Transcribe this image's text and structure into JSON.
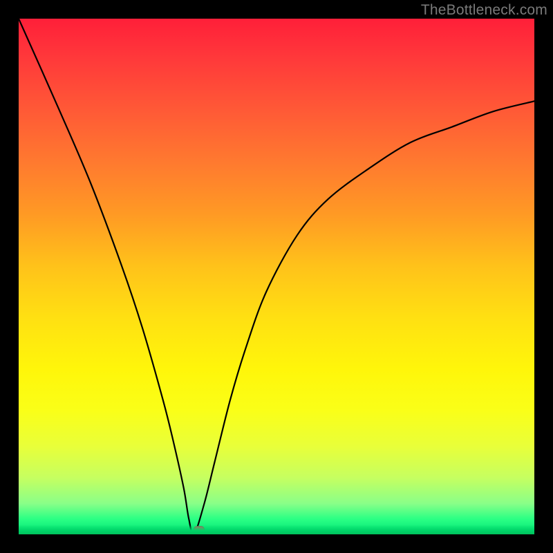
{
  "attribution": "TheBottleneck.com",
  "chart_data": {
    "type": "line",
    "title": "",
    "xlabel": "",
    "ylabel": "",
    "x_range": [
      0,
      100
    ],
    "y_range": [
      0,
      100
    ],
    "min_point": {
      "x": 34,
      "y": 0
    },
    "marker": {
      "x": 35,
      "y": 1,
      "color": "#c9605e"
    },
    "series": [
      {
        "name": "bottleneck-curve",
        "x": [
          0,
          8,
          14,
          20,
          24,
          28,
          30,
          32,
          33,
          34,
          36,
          38,
          41,
          44,
          48,
          54,
          60,
          68,
          76,
          84,
          92,
          100
        ],
        "y": [
          100,
          82,
          68,
          52,
          40,
          26,
          18,
          9,
          3,
          0,
          6,
          14,
          26,
          36,
          47,
          58,
          65,
          71,
          76,
          79,
          82,
          84
        ]
      }
    ],
    "background_gradient": {
      "top": "#ff1f39",
      "middle": "#ffe012",
      "bottom": "#00d468"
    }
  }
}
